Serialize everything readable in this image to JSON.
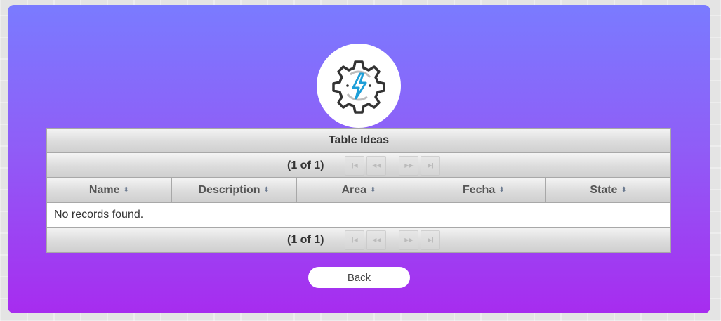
{
  "logo": {
    "icon": "gear-lightning-icon",
    "gear_color": "#333333",
    "bolt_color": "#1e9fd8"
  },
  "table": {
    "title": "Table Ideas",
    "paginator_text": "(1 of 1)",
    "columns": [
      "Name",
      "Description",
      "Area",
      "Fecha",
      "State"
    ],
    "empty_message": "No records found.",
    "paginator_buttons": {
      "first": "|◀",
      "prev": "◀◀",
      "next": "▶▶",
      "last": "▶|"
    }
  },
  "back_button": {
    "label": "Back"
  },
  "colors": {
    "gradient_top": "#7a7bff",
    "gradient_bottom": "#a72cef"
  }
}
